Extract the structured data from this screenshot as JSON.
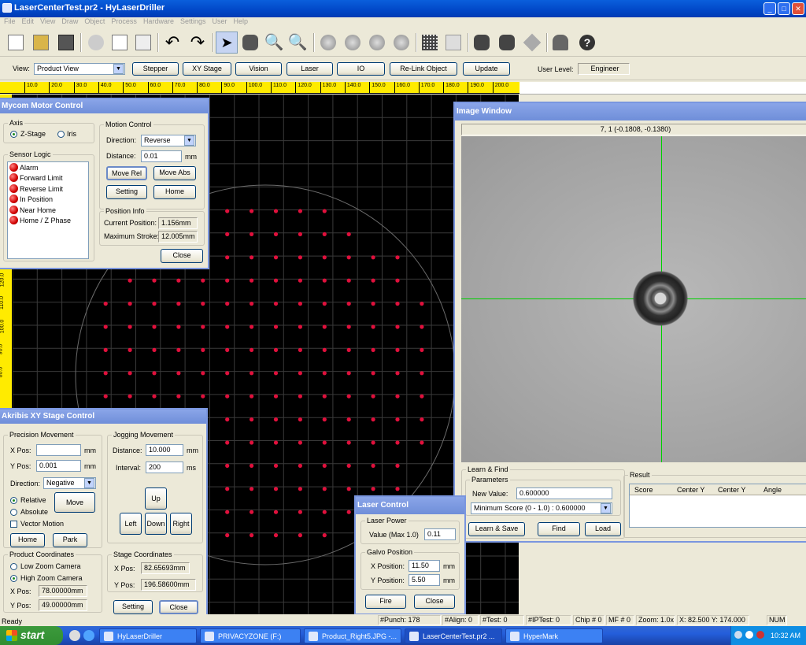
{
  "window": {
    "title": "LaserCenterTest.pr2 - HyLaserDriller"
  },
  "menu": [
    "File",
    "Edit",
    "View",
    "Draw",
    "Object",
    "Process",
    "Hardware",
    "Settings",
    "User",
    "Help"
  ],
  "toolbar_icons": [
    "new-file-icon",
    "open-folder-icon",
    "save-icon",
    "cut-icon",
    "copy-icon",
    "paste-icon",
    "undo-icon",
    "redo-icon",
    "select-pointer-icon",
    "hexagon-tool-icon",
    "zoom-in-icon",
    "zoom-out-icon",
    "circle-tool-1-icon",
    "circle-tool-2-icon",
    "circle-tool-3-icon",
    "circle-tool-4-icon",
    "grid-array-icon",
    "single-point-icon",
    "camera-icon",
    "camera-settings-icon",
    "move-tool-icon",
    "users-icon",
    "help-icon"
  ],
  "viewbar": {
    "view_label": "View:",
    "view_value": "Product View",
    "buttons": [
      "Stepper",
      "XY Stage",
      "Vision",
      "Laser",
      "IO",
      "Re-Link Object",
      "Update"
    ],
    "user_level_label": "User Level:",
    "user_level_value": "Engineer"
  },
  "ruler": {
    "top_ticks": [
      "10.0",
      "20.0",
      "30.0",
      "40.0",
      "50.0",
      "60.0",
      "70.0",
      "80.0",
      "90.0",
      "100.0",
      "110.0",
      "120.0",
      "130.0",
      "140.0",
      "150.0",
      "160.0",
      "170.0",
      "180.0",
      "190.0",
      "200.0"
    ],
    "left_ticks": [
      "120.0",
      "110.0",
      "100.0",
      "90.0",
      "80.0"
    ]
  },
  "motor": {
    "title": "Mycom Motor Control",
    "axis_label": "Axis",
    "axis_opts": [
      "Z-Stage",
      "Iris"
    ],
    "sensor_label": "Sensor Logic",
    "sensors": [
      "Alarm",
      "Forward Limit",
      "Reverse Limit",
      "In Position",
      "Near Home",
      "Home / Z Phase"
    ],
    "motion_label": "Motion Control",
    "direction_label": "Direction:",
    "direction_value": "Reverse",
    "distance_label": "Distance:",
    "distance_value": "0.01",
    "distance_unit": "mm",
    "btn_move_rel": "Move Rel",
    "btn_move_abs": "Move Abs",
    "btn_setting": "Setting",
    "btn_home": "Home",
    "pos_label": "Position Info",
    "current_label": "Current Position:",
    "current_value": "1.156mm",
    "max_label": "Maximum Stroke:",
    "max_value": "12.005mm",
    "btn_close": "Close"
  },
  "xy": {
    "title": "Akribis XY Stage Control",
    "precision_label": "Precision Movement",
    "xpos_label": "X Pos:",
    "xpos_value": "",
    "ypos_label": "Y Pos:",
    "ypos_value": "0.001",
    "unit": "mm",
    "direction_label": "Direction:",
    "direction_value": "Negative",
    "relative": "Relative",
    "absolute": "Absolute",
    "vector": "Vector Motion",
    "btn_move": "Move",
    "btn_home": "Home",
    "btn_park": "Park",
    "jog_label": "Jogging Movement",
    "jdist_label": "Distance:",
    "jdist_value": "10.000",
    "jdist_unit": "mm",
    "jint_label": "Interval:",
    "jint_value": "200",
    "jint_unit": "ms",
    "btn_up": "Up",
    "btn_left": "Left",
    "btn_down": "Down",
    "btn_right": "Right",
    "product_label": "Product Coordinates",
    "low_zoom": "Low Zoom Camera",
    "high_zoom": "High Zoom Camera",
    "p_xpos_label": "X Pos:",
    "p_xpos_value": "78.00000mm",
    "p_ypos_label": "Y Pos:",
    "p_ypos_value": "49.00000mm",
    "stage_label": "Stage Coordinates",
    "s_xpos_label": "X Pos:",
    "s_xpos_value": "82.65693mm",
    "s_ypos_label": "Y Pos:",
    "s_ypos_value": "196.58600mm",
    "btn_setting": "Setting",
    "btn_close": "Close"
  },
  "image": {
    "title": "Image Window",
    "coord": "7, 1 (-0.1808, -0.1380)",
    "learn_label": "Learn & Find",
    "params_label": "Parameters",
    "new_value_label": "New Value:",
    "new_value": "0.600000",
    "score_select": "Minimum Score (0 - 1.0) : 0.600000",
    "btn_learn": "Learn & Save",
    "btn_find": "Find",
    "btn_load": "Load",
    "result_label": "Result",
    "result_cols": [
      "Score",
      "Center Y",
      "Center Y",
      "Angle"
    ]
  },
  "laser": {
    "title": "Laser Control",
    "power_label": "Laser Power",
    "value_label": "Value (Max 1.0)",
    "value": "0.11",
    "galvo_label": "Galvo Position",
    "xpos_label": "X Position:",
    "xpos_value": "11.50",
    "ypos_label": "Y Position:",
    "ypos_value": "5.50",
    "unit": "mm",
    "btn_fire": "Fire",
    "btn_close": "Close"
  },
  "status": {
    "ready": "Ready",
    "punch": "#Punch:     178",
    "align": "#Align:  0",
    "test": "#Test:   0",
    "iptest": "#IPTest:  0",
    "chip": "Chip # 0",
    "mf": "MF # 0",
    "zoom": "Zoom:  1.0x",
    "xy": "X: 82.500 Y: 174.000",
    "num": "NUM"
  },
  "taskbar": {
    "start": "start",
    "tasks": [
      "HyLaserDriller",
      "PRIVACYZONE (F:)",
      "Product_Right5.JPG -...",
      "LaserCenterTest.pr2 ...",
      "HyperMark"
    ],
    "clock": "10:32 AM"
  },
  "colors": {
    "title_blue": "#0147c7",
    "inactive_title": "#7a96df",
    "canvas": "#000000",
    "dot": "#e0103c",
    "ruler": "#ffeb00",
    "crosshair": "#00d000"
  }
}
